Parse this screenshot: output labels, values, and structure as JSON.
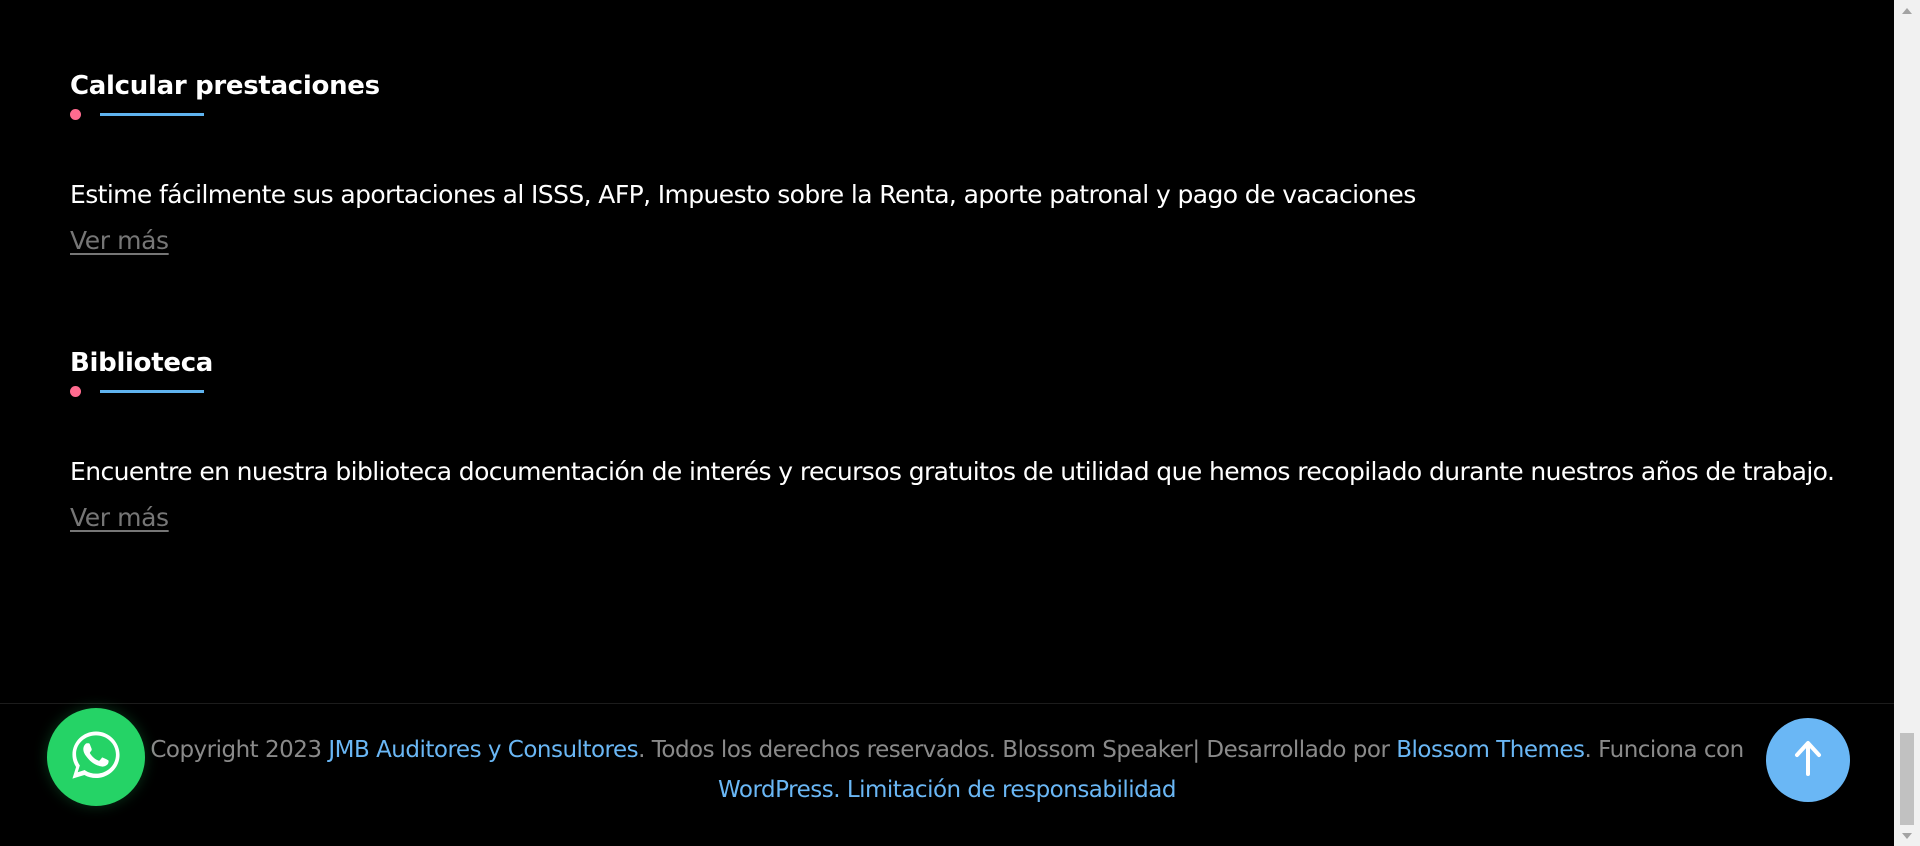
{
  "colors": {
    "background": "#000000",
    "title": "#ffffff",
    "text": "#ffffff",
    "link_muted": "#767676",
    "footer_text": "#8a8a8a",
    "footer_link": "#6ab7f5",
    "accent_dot": "#ff6b8f",
    "accent_line": "#5fb3ef",
    "whatsapp": "#25d366",
    "scroll_top": "#6ab7f5"
  },
  "sections": [
    {
      "title": "Calcular prestaciones",
      "description": "Estime fácilmente sus aportaciones al ISSS, AFP, Impuesto sobre la Renta, aporte patronal y pago de vacaciones",
      "link_label": "Ver más"
    },
    {
      "title": "Biblioteca",
      "description": "Encuentre en nuestra biblioteca documentación de interés y recursos gratuitos de utilidad que hemos recopilado durante nuestros años de trabajo.",
      "link_label": "Ver más"
    }
  ],
  "footer": {
    "copyright_prefix": "Copyright 2023 ",
    "company_link": "JMB Auditores y Consultores",
    "rights_text": ". Todos los derechos reservados. Blossom Speaker| Desarrollado por ",
    "theme_link": "Blossom Themes",
    "powered_text": ". Funciona con ",
    "wordpress_link": "WordPress",
    "separator": ". ",
    "disclaimer_link": "Limitación de responsabilidad"
  },
  "icons": {
    "whatsapp": "whatsapp-icon",
    "scroll_top": "arrow-up-icon",
    "scrollbar_up": "scroll-up-arrow",
    "scrollbar_down": "scroll-down-arrow"
  }
}
